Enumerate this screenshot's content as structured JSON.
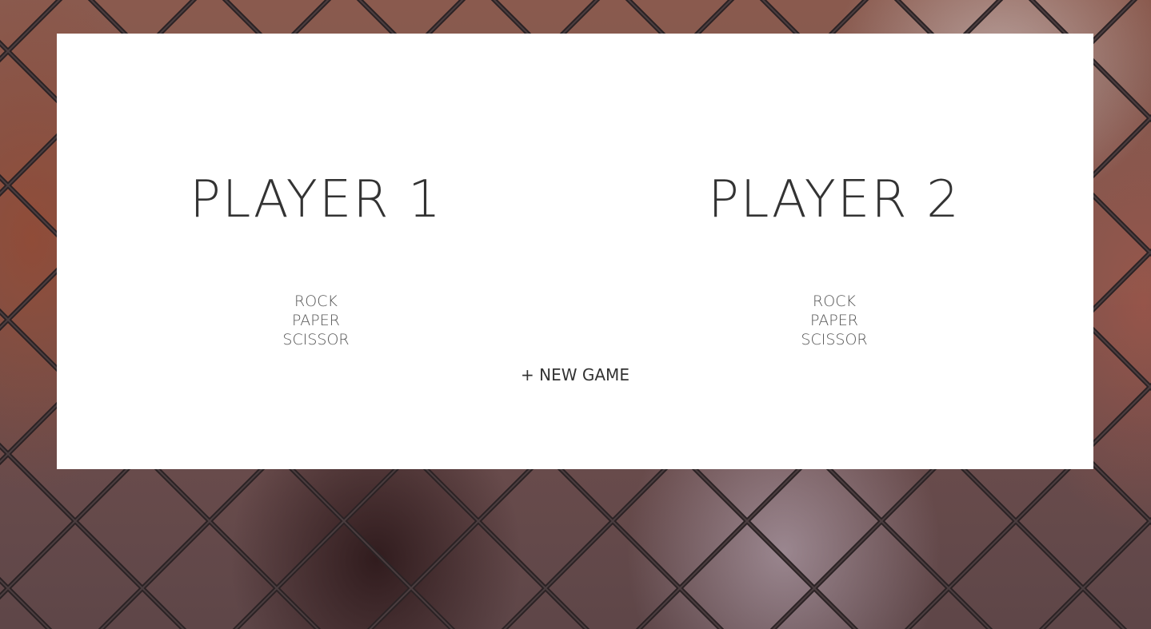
{
  "background": {
    "description_icon": "chain-link-fence-photo"
  },
  "players": [
    {
      "name": "PLAYER 1",
      "choices": [
        "ROCK",
        "PAPER",
        "SCISSOR"
      ]
    },
    {
      "name": "PLAYER 2",
      "choices": [
        "ROCK",
        "PAPER",
        "SCISSOR"
      ]
    }
  ],
  "new_game_label": "+ NEW GAME",
  "colors": {
    "card": "#ffffff",
    "text": "#333333"
  }
}
